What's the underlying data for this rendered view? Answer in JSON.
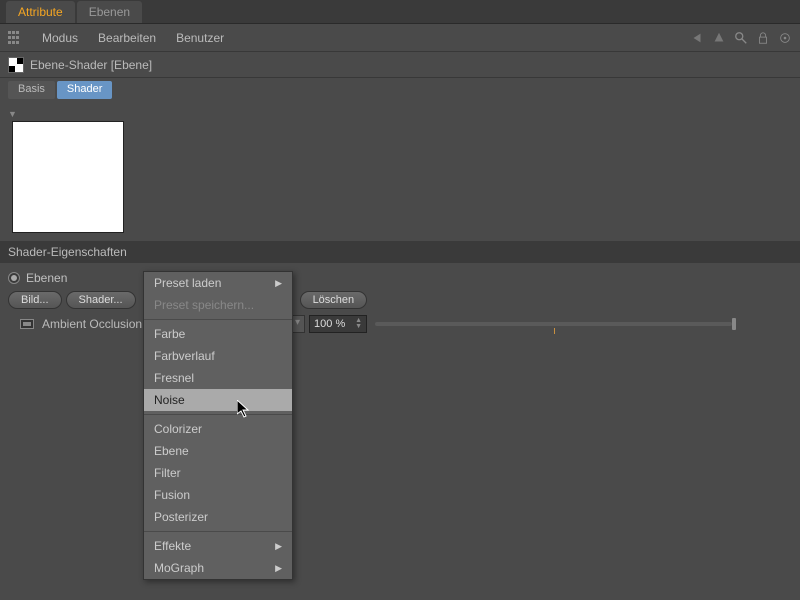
{
  "topTabs": {
    "attribute": "Attribute",
    "ebenen": "Ebenen"
  },
  "menuBar": {
    "modus": "Modus",
    "bearbeiten": "Bearbeiten",
    "benutzer": "Benutzer"
  },
  "breadcrumb": "Ebene-Shader [Ebene]",
  "subTabs": {
    "basis": "Basis",
    "shader": "Shader"
  },
  "sectionHeader": "Shader-Eigenschaften",
  "radioLabel": "Ebenen",
  "buttons": {
    "bild": "Bild...",
    "shader": "Shader...",
    "loeschen": "Löschen"
  },
  "layer": {
    "name": "Ambient Occlusion",
    "percent": "100 %"
  },
  "contextMenu": {
    "presetLaden": "Preset laden",
    "presetSpeichern": "Preset speichern...",
    "farbe": "Farbe",
    "farbverlauf": "Farbverlauf",
    "fresnel": "Fresnel",
    "noise": "Noise",
    "colorizer": "Colorizer",
    "ebene": "Ebene",
    "filter": "Filter",
    "fusion": "Fusion",
    "posterizer": "Posterizer",
    "effekte": "Effekte",
    "mograph": "MoGraph"
  }
}
